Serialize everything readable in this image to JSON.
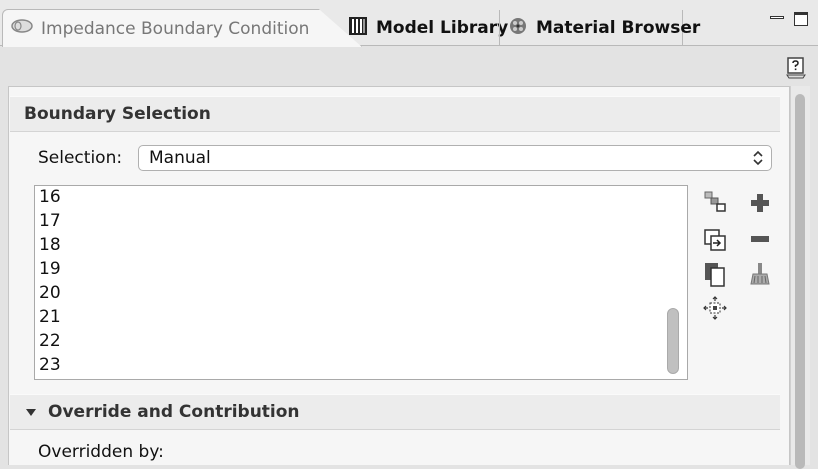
{
  "tabs": [
    {
      "label": "Impedance Boundary Condition",
      "icon": "impedance-icon",
      "active": true
    },
    {
      "label": "Model Library",
      "icon": "model-library-icon",
      "active": false
    },
    {
      "label": "Material Browser",
      "icon": "material-browser-icon",
      "active": false
    }
  ],
  "boundary_selection": {
    "title": "Boundary Selection",
    "selection_label": "Selection:",
    "selection_value": "Manual",
    "items": [
      "16",
      "17",
      "18",
      "19",
      "20",
      "21",
      "22",
      "23"
    ]
  },
  "override": {
    "title": "Override and Contribution",
    "overridden_label": "Overridden by:"
  }
}
